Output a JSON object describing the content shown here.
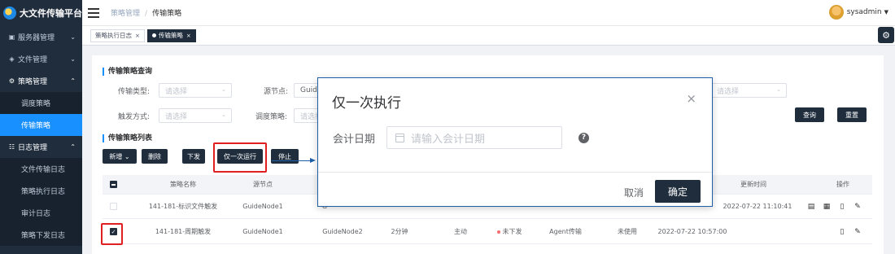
{
  "app": {
    "brand": "大文件传输平台"
  },
  "sidebar": {
    "items": [
      {
        "label": "服务器管理",
        "icon": "server-icon",
        "chevron": "⌄"
      },
      {
        "label": "文件管理",
        "icon": "file-icon",
        "chevron": "⌄"
      },
      {
        "label": "策略管理",
        "icon": "policy-icon",
        "chevron": "⌃"
      },
      {
        "label": "调度策略"
      },
      {
        "label": "传输策略"
      },
      {
        "label": "日志管理",
        "icon": "log-icon",
        "chevron": "⌃"
      },
      {
        "label": "文件传输日志"
      },
      {
        "label": "策略执行日志"
      },
      {
        "label": "审计日志"
      },
      {
        "label": "策略下发日志"
      }
    ]
  },
  "header": {
    "breadcrumb": [
      "策略管理",
      "传输策略"
    ],
    "separator": "/",
    "user": "sysadmin"
  },
  "tags": [
    {
      "label": "策略执行日志",
      "close": "×"
    },
    {
      "label": "传输策略",
      "close": "×"
    }
  ],
  "query": {
    "title": "传输策略查询",
    "transfer_type_label": "传输类型:",
    "source_node_label": "源节点:",
    "source_node_value": "Guid",
    "trigger_label": "触发方式:",
    "schedule_label": "调度策略:",
    "placeholder": "请选择",
    "search_btn": "查询",
    "reset_btn": "重置"
  },
  "list": {
    "title": "传输策略列表",
    "add_btn": "新增",
    "delete_btn": "删除",
    "dispatch_btn": "下发",
    "run_once_btn": "仅一次运行",
    "stop_btn": "停止"
  },
  "table": {
    "headers": [
      "策略名称",
      "源节点",
      "更新时间",
      "操作"
    ],
    "rows": [
      {
        "name": "141-181-标识文件触发",
        "source": "GuideNode1",
        "target": "G",
        "updated": "2022-07-22 11:10:41",
        "checked": false
      },
      {
        "name": "141-181-周期触发",
        "source": "GuideNode1",
        "target": "GuideNode2",
        "interval": "2分钟",
        "mode": "主动",
        "status": "未下发",
        "agent": "Agent传输",
        "usage": "未使用",
        "created": "2022-07-22 10:57:00",
        "updated": "",
        "checked": true
      }
    ]
  },
  "modal": {
    "title": "仅一次执行",
    "close": "×",
    "label": "会计日期",
    "placeholder": "请输入会计日期",
    "help": "?",
    "cancel": "取消",
    "ok": "确定"
  },
  "colors": {
    "sidebar_bg": "#1f2d3d",
    "active": "#1890ff",
    "highlight": "#e02020"
  }
}
